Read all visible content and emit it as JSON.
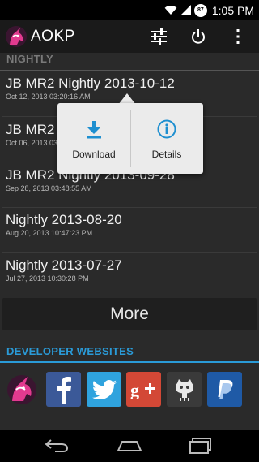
{
  "status_bar": {
    "time": "1:05 PM",
    "battery_level": "87",
    "icons": [
      "wifi-icon",
      "signal-icon",
      "battery-icon"
    ]
  },
  "action_bar": {
    "title": "AOKP",
    "actions": [
      "settings-sliders-icon",
      "power-icon",
      "overflow-menu-icon"
    ]
  },
  "nightly_section": {
    "header": "NIGHTLY",
    "accent_color": "#7a7a7a"
  },
  "builds": [
    {
      "title": "JB MR2 Nightly 2013-10-12",
      "date": "Oct 12, 2013 03:20:16 AM"
    },
    {
      "title": "JB MR2 Nightly 2013-10-06",
      "date": "Oct 06, 2013 03:20:12 AM"
    },
    {
      "title": "JB MR2 Nightly 2013-09-28",
      "date": "Sep 28, 2013 03:48:55 AM"
    },
    {
      "title": "Nightly 2013-08-20",
      "date": "Aug 20, 2013 10:47:23 PM"
    },
    {
      "title": "Nightly 2013-07-27",
      "date": "Jul 27, 2013 10:30:28 PM"
    }
  ],
  "more_label": "More",
  "developer_section": {
    "header": "DEVELOPER WEBSITES",
    "accent_color": "#2a9bd8"
  },
  "developer_sites": [
    {
      "icon": "aokp-unicorn-icon",
      "color": "#2a2a2a"
    },
    {
      "icon": "facebook-icon",
      "color": "#3b5998"
    },
    {
      "icon": "twitter-icon",
      "color": "#2fa3de"
    },
    {
      "icon": "google-plus-icon",
      "color": "#d34836"
    },
    {
      "icon": "github-icon",
      "color": "#3a3a3a"
    },
    {
      "icon": "paypal-icon",
      "color": "#1f5aa6"
    }
  ],
  "popup": {
    "download_label": "Download",
    "details_label": "Details",
    "icon_color": "#1e8fd0"
  },
  "nav_bar": {
    "buttons": [
      "back-icon",
      "home-icon",
      "recent-apps-icon"
    ]
  }
}
